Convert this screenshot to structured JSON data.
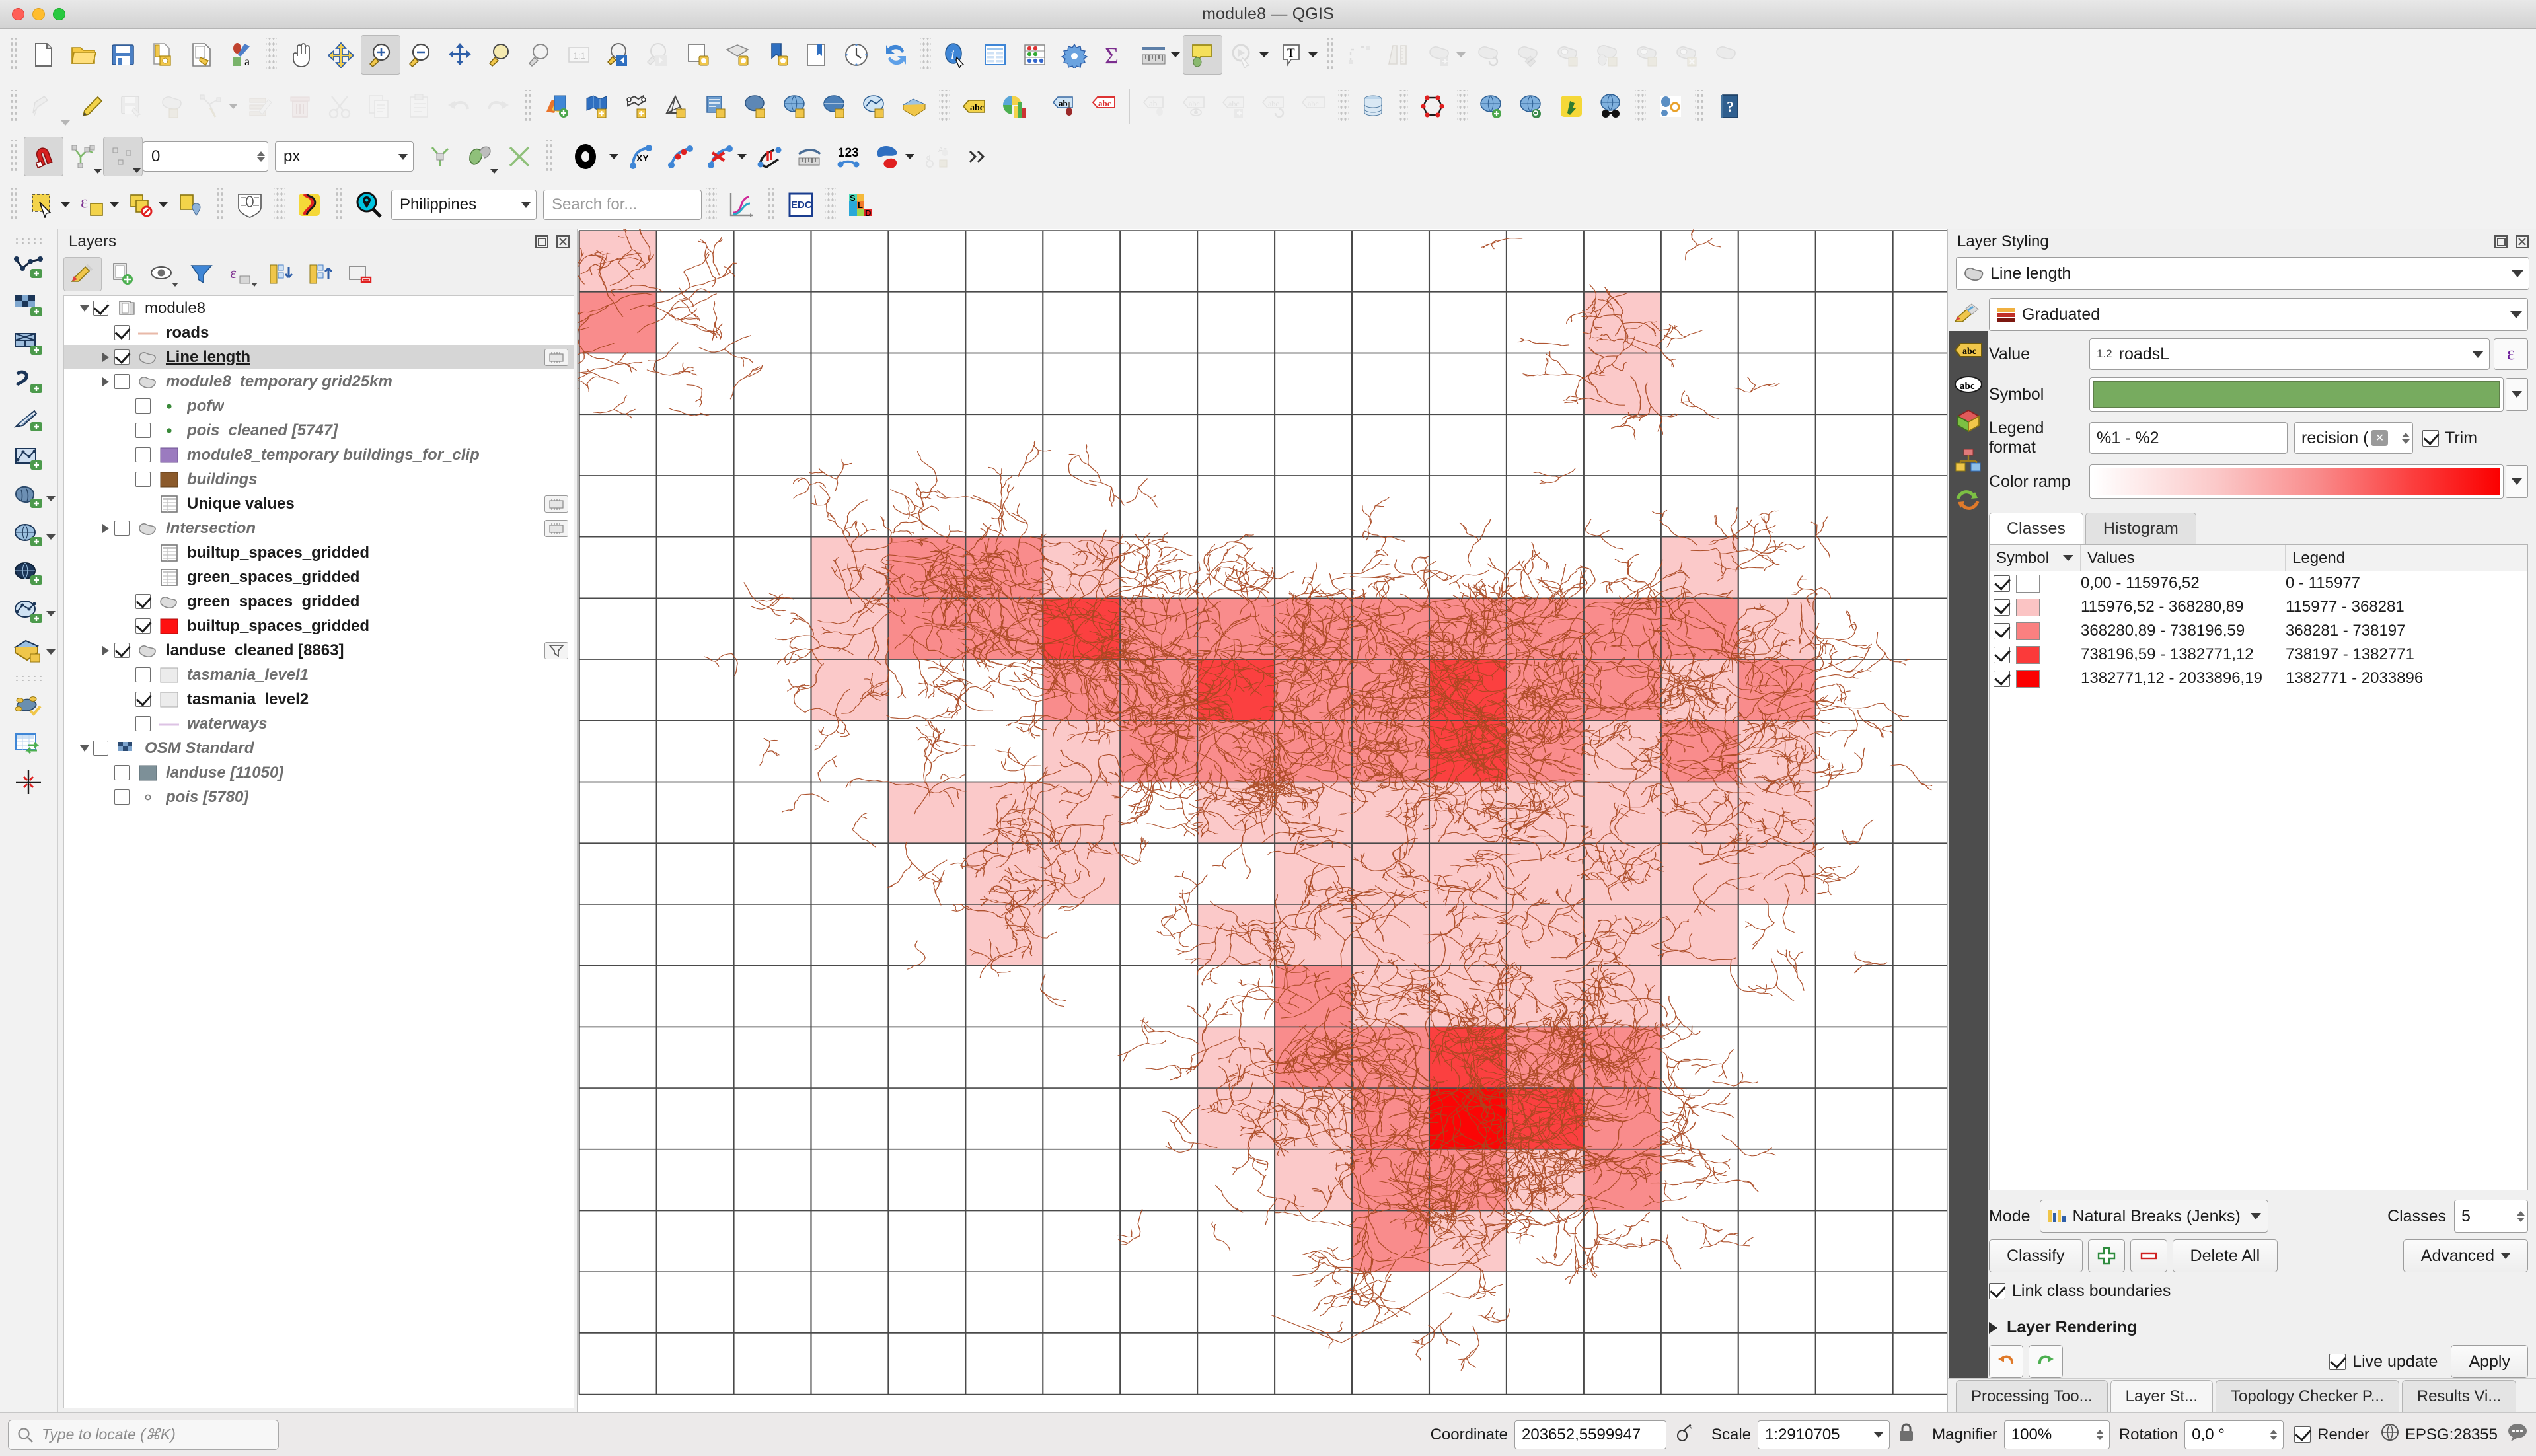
{
  "window": {
    "title": "module8 — QGIS"
  },
  "toolbars": {
    "row1": [
      {
        "name": "new-project-icon",
        "label": "New Project"
      },
      {
        "name": "open-project-icon",
        "label": "Open Project"
      },
      {
        "name": "save-project-icon",
        "label": "Save Project"
      },
      {
        "name": "save-project-as-icon",
        "label": "Save Project As"
      },
      {
        "name": "new-print-layout-icon",
        "label": "New Print Layout"
      },
      {
        "name": "style-manager-icon",
        "label": "Style Manager"
      },
      {
        "name": "pan-map-icon",
        "label": "Pan Map"
      },
      {
        "name": "pan-to-selection-icon",
        "label": "Pan Map to Selection"
      },
      {
        "name": "zoom-in-icon",
        "label": "Zoom In"
      },
      {
        "name": "zoom-out-icon",
        "label": "Zoom Out"
      },
      {
        "name": "zoom-full-icon",
        "label": "Zoom Full"
      },
      {
        "name": "zoom-to-selection-icon",
        "label": "Zoom To Selection"
      },
      {
        "name": "zoom-to-layer-icon",
        "label": "Zoom To Layer"
      },
      {
        "name": "zoom-native-icon",
        "label": "Zoom to Native Resolution"
      },
      {
        "name": "zoom-last-icon",
        "label": "Zoom Last"
      },
      {
        "name": "zoom-next-icon",
        "label": "Zoom Next"
      },
      {
        "name": "new-map-view-icon",
        "label": "New Map View"
      },
      {
        "name": "new-3d-map-view-icon",
        "label": "New 3D Map View"
      },
      {
        "name": "refresh-icon",
        "label": "Refresh"
      },
      {
        "name": "identify-features-icon",
        "label": "Identify Features"
      },
      {
        "name": "open-attribute-table-icon",
        "label": "Open Attribute Table"
      },
      {
        "name": "statistical-summary-icon",
        "label": "Statistical Summary"
      },
      {
        "name": "processing-toolbox-icon",
        "label": "Processing Toolbox"
      },
      {
        "name": "sum-icon",
        "label": "Field Calculator"
      },
      {
        "name": "measure-icon",
        "label": "Measure Line"
      },
      {
        "name": "map-tips-icon",
        "label": "Show Map Tips"
      },
      {
        "name": "text-annotation-icon",
        "label": "Text Annotation"
      }
    ],
    "row2_label": "Digitizing toolbar",
    "row3": {
      "snap_value": "0",
      "snap_units": "px"
    },
    "row4": {
      "country": "Philippines",
      "search_placeholder": "Search for...",
      "edc_label": "EDC"
    }
  },
  "layers_panel": {
    "title": "Layers",
    "items": [
      {
        "label": "module8",
        "indent": 0,
        "expander": "open",
        "check": "on",
        "sym": "group",
        "style": "plain",
        "badge": false
      },
      {
        "label": "roads",
        "indent": 1,
        "expander": "none",
        "check": "on",
        "sym": "line-pink",
        "style": "bold",
        "badge": false
      },
      {
        "label": "Line length",
        "indent": 1,
        "expander": "closed",
        "check": "on",
        "sym": "poly-grey",
        "style": "bold-underline",
        "badge": true,
        "selected": true
      },
      {
        "label": "module8_temporary grid25km",
        "indent": 1,
        "expander": "closed",
        "check": "off",
        "sym": "poly-grey",
        "style": "bold-italic",
        "badge": false
      },
      {
        "label": "pofw",
        "indent": 2,
        "expander": "none",
        "check": "off",
        "sym": "dot-green",
        "style": "bold-italic",
        "badge": false
      },
      {
        "label": "pois_cleaned [5747]",
        "indent": 2,
        "expander": "none",
        "check": "off",
        "sym": "dot-green",
        "style": "bold-italic",
        "badge": false
      },
      {
        "label": "module8_temporary buildings_for_clip",
        "indent": 2,
        "expander": "none",
        "check": "off",
        "sym": "fill-purple",
        "style": "bold-italic",
        "badge": false
      },
      {
        "label": "buildings",
        "indent": 2,
        "expander": "none",
        "check": "off",
        "sym": "fill-brown",
        "style": "bold-italic",
        "badge": false
      },
      {
        "label": "Unique values",
        "indent": 2,
        "expander": "none",
        "check": "none",
        "sym": "table",
        "style": "bold",
        "badge": true
      },
      {
        "label": "Intersection",
        "indent": 1,
        "expander": "closed",
        "check": "off",
        "sym": "poly-grey",
        "style": "bold-italic",
        "badge": true
      },
      {
        "label": "builtup_spaces_gridded",
        "indent": 2,
        "expander": "none",
        "check": "none",
        "sym": "table",
        "style": "bold",
        "badge": false
      },
      {
        "label": "green_spaces_gridded",
        "indent": 2,
        "expander": "none",
        "check": "none",
        "sym": "table",
        "style": "bold",
        "badge": false
      },
      {
        "label": "green_spaces_gridded",
        "indent": 2,
        "expander": "none",
        "check": "on",
        "sym": "poly-grey",
        "style": "bold",
        "badge": false
      },
      {
        "label": "builtup_spaces_gridded",
        "indent": 2,
        "expander": "none",
        "check": "on",
        "sym": "fill-red",
        "style": "bold",
        "badge": false
      },
      {
        "label": "landuse_cleaned [8863]",
        "indent": 1,
        "expander": "closed",
        "check": "on",
        "sym": "poly-grey",
        "style": "bold",
        "badge": "filter"
      },
      {
        "label": "tasmania_level1",
        "indent": 2,
        "expander": "none",
        "check": "off",
        "sym": "fill-white",
        "style": "bold-italic",
        "badge": false
      },
      {
        "label": "tasmania_level2",
        "indent": 2,
        "expander": "none",
        "check": "on",
        "sym": "fill-white",
        "style": "bold",
        "badge": false
      },
      {
        "label": "waterways",
        "indent": 2,
        "expander": "none",
        "check": "off",
        "sym": "line-violet",
        "style": "bold-italic",
        "badge": false
      },
      {
        "label": "OSM Standard",
        "indent": 0,
        "expander": "open",
        "check": "off",
        "sym": "checker",
        "style": "bold-italic",
        "badge": false
      },
      {
        "label": "landuse [11050]",
        "indent": 1,
        "expander": "none",
        "check": "off",
        "sym": "fill-slate",
        "style": "bold-italic",
        "badge": false
      },
      {
        "label": "pois [5780]",
        "indent": 1,
        "expander": "none",
        "check": "off",
        "sym": "dot-hollow",
        "style": "bold-italic",
        "badge": false
      }
    ]
  },
  "styling": {
    "title": "Layer Styling",
    "layer_name": "Line length",
    "renderer": "Graduated",
    "value_label": "Value",
    "value_field": "roadsL",
    "value_prefix": "1.2",
    "symbol_label": "Symbol",
    "legend_format_label": "Legend format",
    "legend_format": "%1 - %2",
    "precision": "recision (",
    "trim_label": "Trim",
    "trim_checked": true,
    "color_ramp_label": "Color ramp",
    "tabs": [
      {
        "label": "Classes",
        "active": true
      },
      {
        "label": "Histogram",
        "active": false
      }
    ],
    "table_headers": [
      "Symbol",
      "Values",
      "Legend"
    ],
    "classes": [
      {
        "checked": true,
        "color": "#ffffff",
        "values": "0,00 - 115976,52",
        "legend": "0 - 115977"
      },
      {
        "checked": true,
        "color": "#fbc4c4",
        "values": "115976,52 - 368280,89",
        "legend": "115977 - 368281"
      },
      {
        "checked": true,
        "color": "#fa8080",
        "values": "368280,89 - 738196,59",
        "legend": "368281 - 738197"
      },
      {
        "checked": true,
        "color": "#fb3a3a",
        "values": "738196,59 - 1382771,12",
        "legend": "738197 - 1382771"
      },
      {
        "checked": true,
        "color": "#fb0000",
        "values": "1382771,12 - 2033896,19",
        "legend": "1382771 - 2033896"
      }
    ],
    "mode_label": "Mode",
    "mode": "Natural Breaks (Jenks)",
    "classes_label": "Classes",
    "classes_count": "5",
    "classify_label": "Classify",
    "delete_all_label": "Delete All",
    "advanced_label": "Advanced",
    "link_boundaries_label": "Link class boundaries",
    "link_boundaries_checked": true,
    "layer_rendering_label": "Layer Rendering",
    "live_update_label": "Live update",
    "live_update_checked": true,
    "apply_label": "Apply",
    "accent_green": "#77ab5f",
    "accent_red": "#fb0000"
  },
  "panel_tabs": [
    {
      "label": "Processing Too...",
      "active": false
    },
    {
      "label": "Layer St...",
      "active": true
    },
    {
      "label": "Topology Checker P...",
      "active": false
    },
    {
      "label": "Results Vi...",
      "active": false
    }
  ],
  "status_bar": {
    "locate_placeholder": "Type to locate (⌘K)",
    "coordinate_label": "Coordinate",
    "coordinate_value": "203652,5599947",
    "scale_label": "Scale",
    "scale_value": "1:2910705",
    "magnifier_label": "Magnifier",
    "magnifier_value": "100%",
    "rotation_label": "Rotation",
    "rotation_value": "0,0 °",
    "render_label": "Render",
    "render_checked": true,
    "crs_label": "EPSG:28355"
  },
  "map": {
    "grid_cols": 18,
    "grid_rows": 19,
    "road_color": "#a8471f",
    "grid_line_color": "#4a4a4a",
    "cells": [
      {
        "c": 0,
        "r": 0,
        "v": 1
      },
      {
        "c": 0,
        "r": 1,
        "v": 2
      },
      {
        "c": 13,
        "r": 1,
        "v": 1
      },
      {
        "c": 13,
        "r": 2,
        "v": 1
      },
      {
        "c": 3,
        "r": 5,
        "v": 1
      },
      {
        "c": 4,
        "r": 5,
        "v": 2
      },
      {
        "c": 5,
        "r": 5,
        "v": 2
      },
      {
        "c": 6,
        "r": 5,
        "v": 1
      },
      {
        "c": 14,
        "r": 5,
        "v": 1
      },
      {
        "c": 3,
        "r": 6,
        "v": 1
      },
      {
        "c": 4,
        "r": 6,
        "v": 2
      },
      {
        "c": 5,
        "r": 6,
        "v": 2
      },
      {
        "c": 6,
        "r": 6,
        "v": 3
      },
      {
        "c": 7,
        "r": 6,
        "v": 2
      },
      {
        "c": 8,
        "r": 6,
        "v": 2
      },
      {
        "c": 9,
        "r": 6,
        "v": 2
      },
      {
        "c": 10,
        "r": 6,
        "v": 2
      },
      {
        "c": 11,
        "r": 6,
        "v": 2
      },
      {
        "c": 12,
        "r": 6,
        "v": 2
      },
      {
        "c": 13,
        "r": 6,
        "v": 2
      },
      {
        "c": 14,
        "r": 6,
        "v": 2
      },
      {
        "c": 15,
        "r": 6,
        "v": 1
      },
      {
        "c": 3,
        "r": 7,
        "v": 1
      },
      {
        "c": 6,
        "r": 7,
        "v": 2
      },
      {
        "c": 7,
        "r": 7,
        "v": 2
      },
      {
        "c": 8,
        "r": 7,
        "v": 3
      },
      {
        "c": 9,
        "r": 7,
        "v": 2
      },
      {
        "c": 10,
        "r": 7,
        "v": 2
      },
      {
        "c": 11,
        "r": 7,
        "v": 3
      },
      {
        "c": 12,
        "r": 7,
        "v": 2
      },
      {
        "c": 13,
        "r": 7,
        "v": 2
      },
      {
        "c": 14,
        "r": 7,
        "v": 1
      },
      {
        "c": 15,
        "r": 7,
        "v": 2
      },
      {
        "c": 6,
        "r": 8,
        "v": 1
      },
      {
        "c": 7,
        "r": 8,
        "v": 2
      },
      {
        "c": 8,
        "r": 8,
        "v": 2
      },
      {
        "c": 9,
        "r": 8,
        "v": 2
      },
      {
        "c": 10,
        "r": 8,
        "v": 2
      },
      {
        "c": 11,
        "r": 8,
        "v": 3
      },
      {
        "c": 12,
        "r": 8,
        "v": 2
      },
      {
        "c": 13,
        "r": 8,
        "v": 1
      },
      {
        "c": 14,
        "r": 8,
        "v": 2
      },
      {
        "c": 15,
        "r": 8,
        "v": 1
      },
      {
        "c": 4,
        "r": 9,
        "v": 1
      },
      {
        "c": 5,
        "r": 9,
        "v": 1
      },
      {
        "c": 6,
        "r": 9,
        "v": 1
      },
      {
        "c": 8,
        "r": 9,
        "v": 1
      },
      {
        "c": 9,
        "r": 9,
        "v": 1
      },
      {
        "c": 10,
        "r": 9,
        "v": 1
      },
      {
        "c": 11,
        "r": 9,
        "v": 1
      },
      {
        "c": 12,
        "r": 9,
        "v": 1
      },
      {
        "c": 13,
        "r": 9,
        "v": 1
      },
      {
        "c": 14,
        "r": 9,
        "v": 1
      },
      {
        "c": 15,
        "r": 9,
        "v": 1
      },
      {
        "c": 5,
        "r": 10,
        "v": 1
      },
      {
        "c": 6,
        "r": 10,
        "v": 1
      },
      {
        "c": 9,
        "r": 10,
        "v": 1
      },
      {
        "c": 10,
        "r": 10,
        "v": 1
      },
      {
        "c": 11,
        "r": 10,
        "v": 1
      },
      {
        "c": 12,
        "r": 10,
        "v": 1
      },
      {
        "c": 13,
        "r": 10,
        "v": 1
      },
      {
        "c": 14,
        "r": 10,
        "v": 1
      },
      {
        "c": 15,
        "r": 10,
        "v": 1
      },
      {
        "c": 5,
        "r": 11,
        "v": 1
      },
      {
        "c": 8,
        "r": 11,
        "v": 1
      },
      {
        "c": 9,
        "r": 11,
        "v": 1
      },
      {
        "c": 10,
        "r": 11,
        "v": 1
      },
      {
        "c": 11,
        "r": 11,
        "v": 1
      },
      {
        "c": 12,
        "r": 11,
        "v": 1
      },
      {
        "c": 13,
        "r": 11,
        "v": 1
      },
      {
        "c": 14,
        "r": 11,
        "v": 1
      },
      {
        "c": 9,
        "r": 12,
        "v": 2
      },
      {
        "c": 10,
        "r": 12,
        "v": 1
      },
      {
        "c": 11,
        "r": 12,
        "v": 1
      },
      {
        "c": 12,
        "r": 12,
        "v": 1
      },
      {
        "c": 13,
        "r": 12,
        "v": 1
      },
      {
        "c": 8,
        "r": 13,
        "v": 1
      },
      {
        "c": 9,
        "r": 13,
        "v": 2
      },
      {
        "c": 10,
        "r": 13,
        "v": 2
      },
      {
        "c": 11,
        "r": 13,
        "v": 3
      },
      {
        "c": 12,
        "r": 13,
        "v": 2
      },
      {
        "c": 13,
        "r": 13,
        "v": 2
      },
      {
        "c": 8,
        "r": 14,
        "v": 1
      },
      {
        "c": 9,
        "r": 14,
        "v": 1
      },
      {
        "c": 10,
        "r": 14,
        "v": 2
      },
      {
        "c": 11,
        "r": 14,
        "v": 4
      },
      {
        "c": 12,
        "r": 14,
        "v": 3
      },
      {
        "c": 13,
        "r": 14,
        "v": 2
      },
      {
        "c": 9,
        "r": 15,
        "v": 1
      },
      {
        "c": 10,
        "r": 15,
        "v": 2
      },
      {
        "c": 11,
        "r": 15,
        "v": 2
      },
      {
        "c": 12,
        "r": 15,
        "v": 1
      },
      {
        "c": 13,
        "r": 15,
        "v": 2
      },
      {
        "c": 10,
        "r": 16,
        "v": 2
      },
      {
        "c": 11,
        "r": 16,
        "v": 1
      }
    ],
    "class_colors": [
      "#ffffff",
      "#fbc9c9",
      "#f98c8c",
      "#fb4040",
      "#fb0505"
    ]
  }
}
